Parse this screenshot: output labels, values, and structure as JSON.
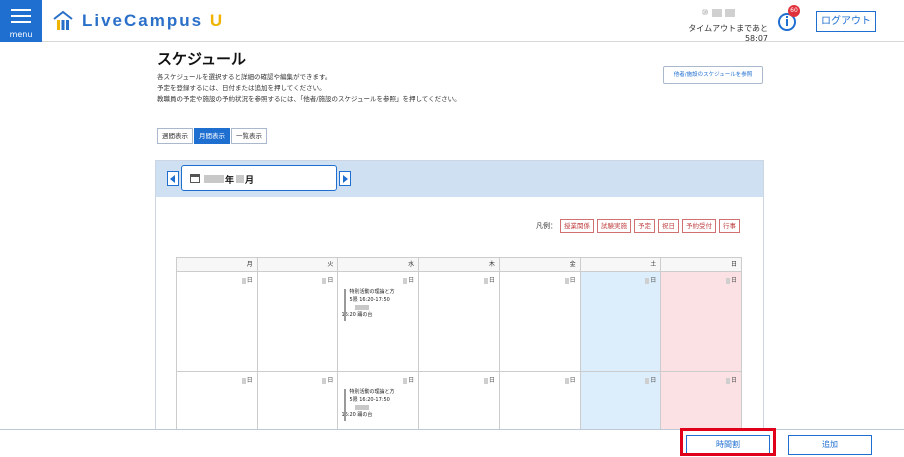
{
  "header": {
    "menu_label": "menu",
    "brand_main": "LiveCampus",
    "brand_suffix": "U",
    "user_prefix": "⑩",
    "timeout_text": "タイムアウトまであと 58:07",
    "notice_count": "60",
    "logout_label": "ログアウト"
  },
  "page": {
    "title": "スケジュール",
    "desc_lines": [
      "各スケジュールを選択すると詳細の確認や編集ができます。",
      "予定を登録するには、日付または追加を押してください。",
      "教職員の予定や施設の予約状況を参照するには、「他者/施設のスケジュールを参照」を押してください。"
    ],
    "ref_button": "他者/施設のスケジュールを参照"
  },
  "view_tabs": [
    {
      "label": "週間表示",
      "active": false
    },
    {
      "label": "月間表示",
      "active": true
    },
    {
      "label": "一覧表示",
      "active": false
    }
  ],
  "calendar": {
    "year_suffix": "年",
    "month_suffix": "月",
    "legend_label": "凡例：",
    "legend_items": [
      "授業関係",
      "試験実施",
      "予定",
      "祝日",
      "予約受付",
      "行事"
    ],
    "days_of_week": [
      "月",
      "火",
      "水",
      "木",
      "金",
      "土",
      "日"
    ],
    "day_suffix": "日",
    "event": {
      "line1": "特別活動の理論と方",
      "line2": "5限 16:20-17:50",
      "line3": "16:20 踊の台"
    }
  },
  "footer": {
    "timetable_label": "時間割",
    "add_label": "追加"
  },
  "colors": {
    "primary": "#1f6fd1",
    "saturday": "#dceefb",
    "sunday": "#fbe0e4",
    "highlight": "#e0001a"
  }
}
